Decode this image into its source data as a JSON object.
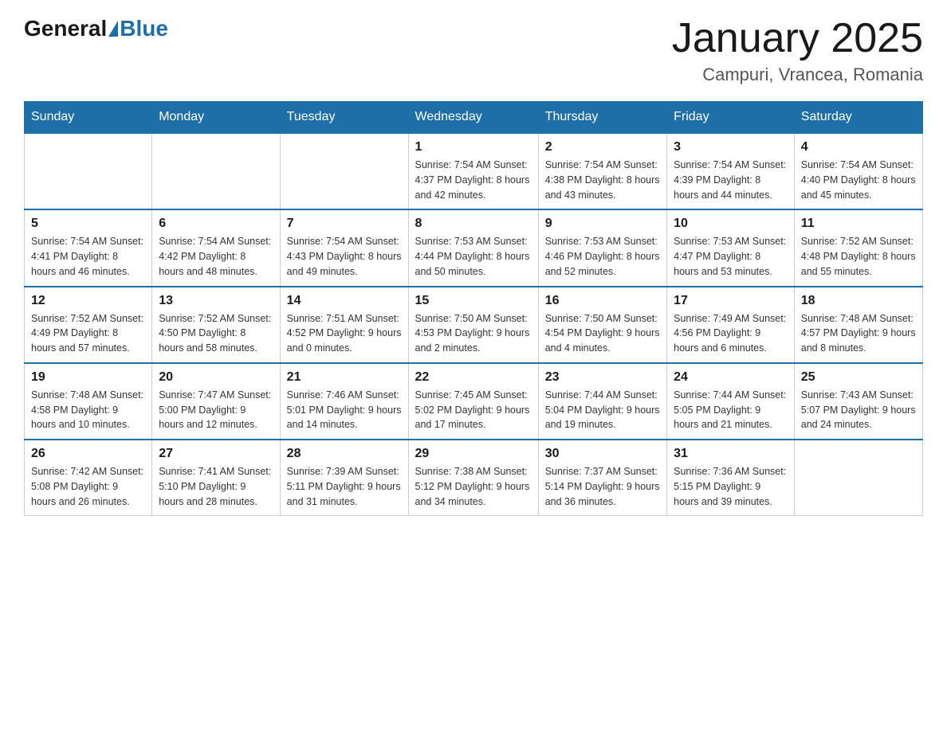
{
  "header": {
    "logo_general": "General",
    "logo_blue": "Blue",
    "month_title": "January 2025",
    "location": "Campuri, Vrancea, Romania"
  },
  "days_of_week": [
    "Sunday",
    "Monday",
    "Tuesday",
    "Wednesday",
    "Thursday",
    "Friday",
    "Saturday"
  ],
  "weeks": [
    [
      {
        "day": "",
        "info": ""
      },
      {
        "day": "",
        "info": ""
      },
      {
        "day": "",
        "info": ""
      },
      {
        "day": "1",
        "info": "Sunrise: 7:54 AM\nSunset: 4:37 PM\nDaylight: 8 hours\nand 42 minutes."
      },
      {
        "day": "2",
        "info": "Sunrise: 7:54 AM\nSunset: 4:38 PM\nDaylight: 8 hours\nand 43 minutes."
      },
      {
        "day": "3",
        "info": "Sunrise: 7:54 AM\nSunset: 4:39 PM\nDaylight: 8 hours\nand 44 minutes."
      },
      {
        "day": "4",
        "info": "Sunrise: 7:54 AM\nSunset: 4:40 PM\nDaylight: 8 hours\nand 45 minutes."
      }
    ],
    [
      {
        "day": "5",
        "info": "Sunrise: 7:54 AM\nSunset: 4:41 PM\nDaylight: 8 hours\nand 46 minutes."
      },
      {
        "day": "6",
        "info": "Sunrise: 7:54 AM\nSunset: 4:42 PM\nDaylight: 8 hours\nand 48 minutes."
      },
      {
        "day": "7",
        "info": "Sunrise: 7:54 AM\nSunset: 4:43 PM\nDaylight: 8 hours\nand 49 minutes."
      },
      {
        "day": "8",
        "info": "Sunrise: 7:53 AM\nSunset: 4:44 PM\nDaylight: 8 hours\nand 50 minutes."
      },
      {
        "day": "9",
        "info": "Sunrise: 7:53 AM\nSunset: 4:46 PM\nDaylight: 8 hours\nand 52 minutes."
      },
      {
        "day": "10",
        "info": "Sunrise: 7:53 AM\nSunset: 4:47 PM\nDaylight: 8 hours\nand 53 minutes."
      },
      {
        "day": "11",
        "info": "Sunrise: 7:52 AM\nSunset: 4:48 PM\nDaylight: 8 hours\nand 55 minutes."
      }
    ],
    [
      {
        "day": "12",
        "info": "Sunrise: 7:52 AM\nSunset: 4:49 PM\nDaylight: 8 hours\nand 57 minutes."
      },
      {
        "day": "13",
        "info": "Sunrise: 7:52 AM\nSunset: 4:50 PM\nDaylight: 8 hours\nand 58 minutes."
      },
      {
        "day": "14",
        "info": "Sunrise: 7:51 AM\nSunset: 4:52 PM\nDaylight: 9 hours\nand 0 minutes."
      },
      {
        "day": "15",
        "info": "Sunrise: 7:50 AM\nSunset: 4:53 PM\nDaylight: 9 hours\nand 2 minutes."
      },
      {
        "day": "16",
        "info": "Sunrise: 7:50 AM\nSunset: 4:54 PM\nDaylight: 9 hours\nand 4 minutes."
      },
      {
        "day": "17",
        "info": "Sunrise: 7:49 AM\nSunset: 4:56 PM\nDaylight: 9 hours\nand 6 minutes."
      },
      {
        "day": "18",
        "info": "Sunrise: 7:48 AM\nSunset: 4:57 PM\nDaylight: 9 hours\nand 8 minutes."
      }
    ],
    [
      {
        "day": "19",
        "info": "Sunrise: 7:48 AM\nSunset: 4:58 PM\nDaylight: 9 hours\nand 10 minutes."
      },
      {
        "day": "20",
        "info": "Sunrise: 7:47 AM\nSunset: 5:00 PM\nDaylight: 9 hours\nand 12 minutes."
      },
      {
        "day": "21",
        "info": "Sunrise: 7:46 AM\nSunset: 5:01 PM\nDaylight: 9 hours\nand 14 minutes."
      },
      {
        "day": "22",
        "info": "Sunrise: 7:45 AM\nSunset: 5:02 PM\nDaylight: 9 hours\nand 17 minutes."
      },
      {
        "day": "23",
        "info": "Sunrise: 7:44 AM\nSunset: 5:04 PM\nDaylight: 9 hours\nand 19 minutes."
      },
      {
        "day": "24",
        "info": "Sunrise: 7:44 AM\nSunset: 5:05 PM\nDaylight: 9 hours\nand 21 minutes."
      },
      {
        "day": "25",
        "info": "Sunrise: 7:43 AM\nSunset: 5:07 PM\nDaylight: 9 hours\nand 24 minutes."
      }
    ],
    [
      {
        "day": "26",
        "info": "Sunrise: 7:42 AM\nSunset: 5:08 PM\nDaylight: 9 hours\nand 26 minutes."
      },
      {
        "day": "27",
        "info": "Sunrise: 7:41 AM\nSunset: 5:10 PM\nDaylight: 9 hours\nand 28 minutes."
      },
      {
        "day": "28",
        "info": "Sunrise: 7:39 AM\nSunset: 5:11 PM\nDaylight: 9 hours\nand 31 minutes."
      },
      {
        "day": "29",
        "info": "Sunrise: 7:38 AM\nSunset: 5:12 PM\nDaylight: 9 hours\nand 34 minutes."
      },
      {
        "day": "30",
        "info": "Sunrise: 7:37 AM\nSunset: 5:14 PM\nDaylight: 9 hours\nand 36 minutes."
      },
      {
        "day": "31",
        "info": "Sunrise: 7:36 AM\nSunset: 5:15 PM\nDaylight: 9 hours\nand 39 minutes."
      },
      {
        "day": "",
        "info": ""
      }
    ]
  ]
}
